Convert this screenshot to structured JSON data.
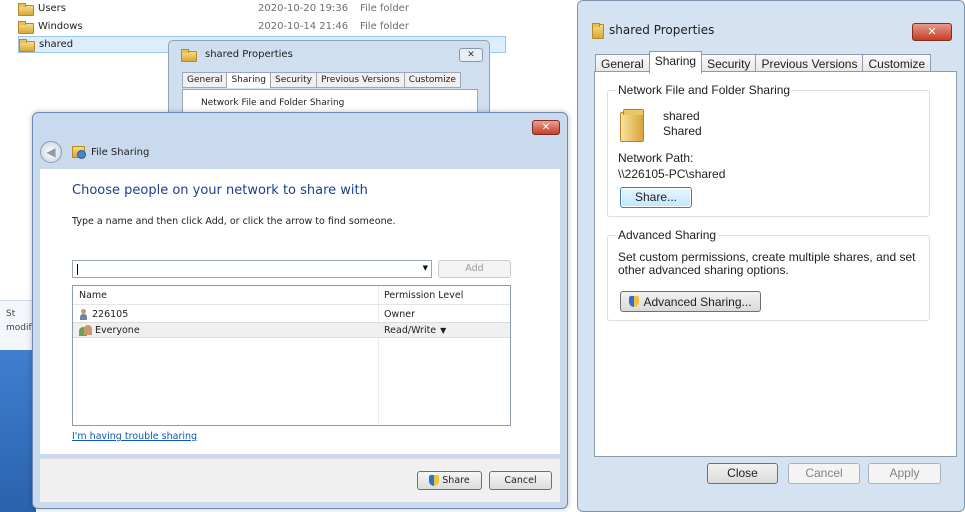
{
  "explorer": {
    "rows": [
      {
        "name": "Users",
        "date": "2020-10-20 19:36",
        "type": "File folder"
      },
      {
        "name": "Windows",
        "date": "2020-10-14 21:46",
        "type": "File folder"
      },
      {
        "name": "shared",
        "date": "",
        "type": ""
      }
    ],
    "side_labels": [
      "St",
      "modif"
    ]
  },
  "bg_properties": {
    "title": "shared Properties",
    "close": "✕",
    "tabs": [
      "General",
      "Sharing",
      "Security",
      "Previous Versions",
      "Customize"
    ],
    "group_label": "Network File and Folder Sharing"
  },
  "file_sharing": {
    "window_title": "File Sharing",
    "close": "✕",
    "heading": "Choose people on your network to share with",
    "instruction": "Type a name and then click Add, or click the arrow to find someone.",
    "input_value": "",
    "add_label": "Add",
    "columns": {
      "name": "Name",
      "permission": "Permission Level"
    },
    "rows": [
      {
        "name": "226105",
        "permission": "Owner",
        "icon": "user-icon"
      },
      {
        "name": "Everyone",
        "permission": "Read/Write",
        "icon": "group-icon",
        "has_dropdown": true
      }
    ],
    "trouble_link": "I'm having trouble sharing",
    "share_label": "Share",
    "cancel_label": "Cancel"
  },
  "properties": {
    "title": "shared Properties",
    "close": "✕",
    "tabs": [
      "General",
      "Sharing",
      "Security",
      "Previous Versions",
      "Customize"
    ],
    "active_tab": "Sharing",
    "network_group": {
      "label": "Network File and Folder Sharing",
      "folder_name": "shared",
      "folder_state": "Shared",
      "network_path_label": "Network Path:",
      "network_path": "\\\\226105-PC\\shared",
      "share_button": "Share..."
    },
    "advanced_group": {
      "label": "Advanced Sharing",
      "description": "Set custom permissions, create multiple shares, and set other advanced sharing options.",
      "button": "Advanced Sharing..."
    },
    "buttons": {
      "close": "Close",
      "cancel": "Cancel",
      "apply": "Apply"
    }
  },
  "colors": {
    "heading_blue": "#1c3f8f",
    "link_blue": "#0b57c3",
    "close_red": "#c4412b",
    "chrome_blue": "#d4e2f2"
  }
}
